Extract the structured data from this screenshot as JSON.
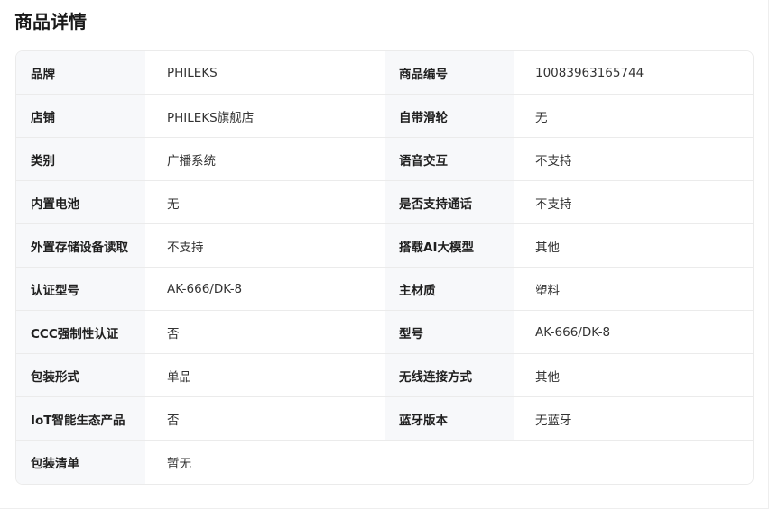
{
  "title": "商品详情",
  "rows": [
    {
      "label1": "品牌",
      "value1": "PHILEKS",
      "label2": "商品编号",
      "value2": "10083963165744"
    },
    {
      "label1": "店铺",
      "value1": "PHILEKS旗舰店",
      "label2": "自带滑轮",
      "value2": "无"
    },
    {
      "label1": "类别",
      "value1": "广播系统",
      "label2": "语音交互",
      "value2": "不支持"
    },
    {
      "label1": "内置电池",
      "value1": "无",
      "label2": "是否支持通话",
      "value2": "不支持"
    },
    {
      "label1": "外置存储设备读取",
      "value1": "不支持",
      "label2": "搭载AI大模型",
      "value2": "其他"
    },
    {
      "label1": "认证型号",
      "value1": "AK-666/DK-8",
      "label2": "主材质",
      "value2": "塑料"
    },
    {
      "label1": "CCC强制性认证",
      "value1": "否",
      "label2": "型号",
      "value2": "AK-666/DK-8"
    },
    {
      "label1": "包装形式",
      "value1": "单品",
      "label2": "无线连接方式",
      "value2": "其他"
    },
    {
      "label1": "IoT智能生态产品",
      "value1": "否",
      "label2": "蓝牙版本",
      "value2": "无蓝牙"
    },
    {
      "label1": "包装清单",
      "value1": "暂无"
    }
  ]
}
